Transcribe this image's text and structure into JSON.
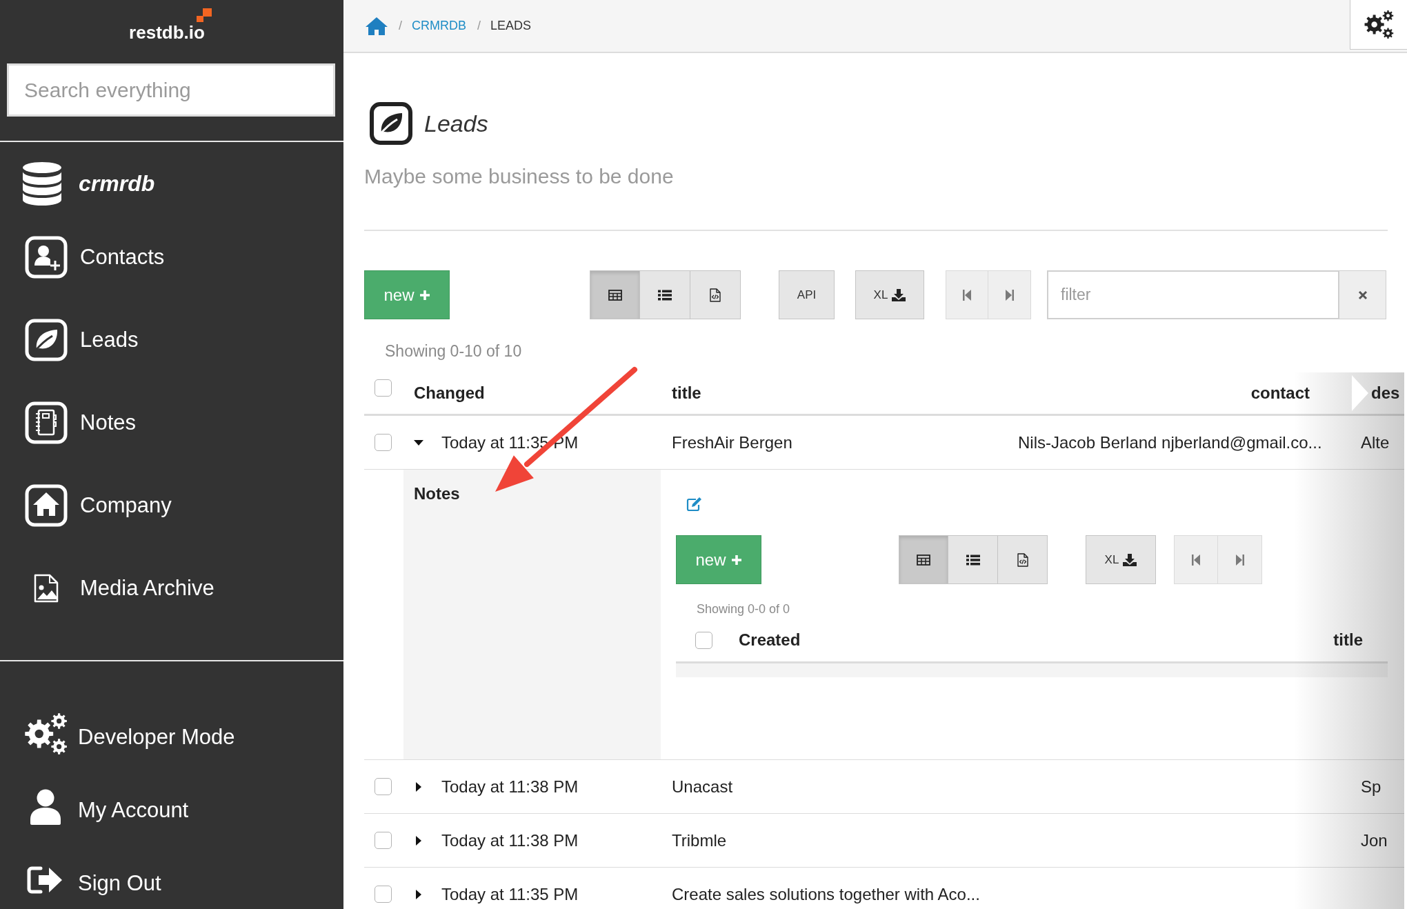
{
  "sidebar": {
    "logo": "restdb.io",
    "search": {
      "placeholder": "Search everything"
    },
    "database": "crmrdb",
    "collections": [
      {
        "label": "Contacts"
      },
      {
        "label": "Leads"
      },
      {
        "label": "Notes"
      },
      {
        "label": "Company"
      },
      {
        "label": "Media Archive"
      }
    ],
    "account_menu": [
      {
        "label": "Developer Mode"
      },
      {
        "label": "My Account"
      },
      {
        "label": "Sign Out"
      }
    ]
  },
  "breadcrumb": {
    "separator": "/",
    "items": [
      {
        "label": "CRMRDB",
        "link": true
      },
      {
        "label": "LEADS",
        "link": false
      }
    ]
  },
  "page": {
    "title": "Leads",
    "description": "Maybe some business to be done"
  },
  "toolbar": {
    "new_label": "new",
    "views": [
      {
        "kind": "table",
        "selected": true
      },
      {
        "kind": "list",
        "selected": false
      },
      {
        "kind": "code",
        "selected": false
      }
    ],
    "api_label": "API",
    "export_label": "XL",
    "paging_disabled": true,
    "filter": {
      "placeholder": "filter"
    }
  },
  "showing": "Showing 0-10 of 10",
  "table": {
    "all_checked": false,
    "columns": [
      "Changed",
      "title",
      "contact",
      "des"
    ],
    "rows": [
      {
        "checked": false,
        "expanded": true,
        "changed": "Today at 11:35 PM",
        "title": "FreshAir Bergen",
        "contact": "Nils-Jacob Berland njberland@gmail.co...",
        "column_4": "Alte",
        "detail": {
          "label": "Notes",
          "toolbar": {
            "new_label": "new",
            "views": [
              {
                "kind": "table",
                "selected": true
              },
              {
                "kind": "list",
                "selected": false
              },
              {
                "kind": "code",
                "selected": false
              }
            ],
            "export_label": "XL",
            "paging_disabled": true
          },
          "showing": "Showing 0-0 of 0",
          "all_checked": false,
          "columns": [
            "Created",
            "title"
          ]
        }
      },
      {
        "checked": false,
        "expanded": false,
        "changed": "Today at 11:38 PM",
        "title": "Unacast",
        "column_4": "Sp"
      },
      {
        "checked": false,
        "expanded": false,
        "changed": "Today at 11:38 PM",
        "title": "Tribmle",
        "column_4": "Jon"
      },
      {
        "checked": false,
        "expanded": false,
        "changed": "Today at 11:35 PM",
        "title": "Create sales solutions together with Aco..."
      }
    ]
  }
}
